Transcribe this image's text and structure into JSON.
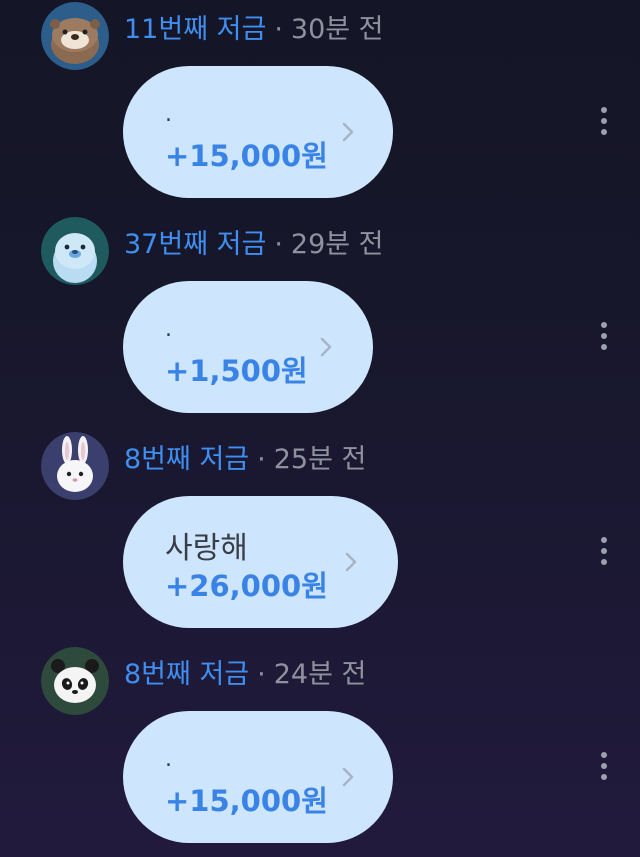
{
  "feed": [
    {
      "avatar": "otter-avatar",
      "title": "11번째 저금",
      "separator": "·",
      "time": "30분 전",
      "message": ".",
      "amount": "+15,000원"
    },
    {
      "avatar": "seal-avatar",
      "title": "37번째 저금",
      "separator": "·",
      "time": "29분 전",
      "message": ".",
      "amount": "+1,500원"
    },
    {
      "avatar": "rabbit-avatar",
      "title": "8번째 저금",
      "separator": "·",
      "time": "25분 전",
      "message": "사랑해",
      "amount": "+26,000원"
    },
    {
      "avatar": "panda-avatar",
      "title": "8번째 저금",
      "separator": "·",
      "time": "24분 전",
      "message": ".",
      "amount": "+15,000원"
    }
  ],
  "colors": {
    "background": "#17172b",
    "title": "#3f8ef0",
    "time": "#8f919e",
    "bubble": "#cde5fd",
    "amount": "#3a83e6"
  },
  "icons": [
    "chevron-right-icon",
    "more-vertical-icon"
  ]
}
